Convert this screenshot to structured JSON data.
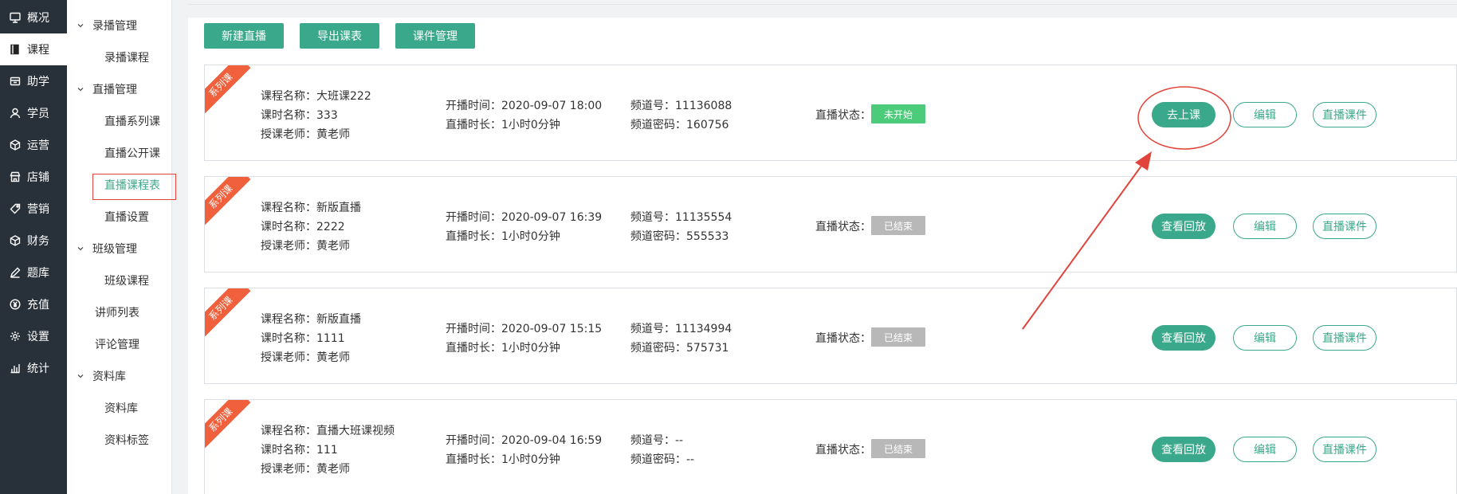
{
  "nav": {
    "items": [
      {
        "label": "概况",
        "icon": "monitor-icon"
      },
      {
        "label": "课程",
        "icon": "book-icon"
      },
      {
        "label": "助学",
        "icon": "box-icon"
      },
      {
        "label": "学员",
        "icon": "user-icon"
      },
      {
        "label": "运营",
        "icon": "cube-icon"
      },
      {
        "label": "店铺",
        "icon": "store-icon"
      },
      {
        "label": "营销",
        "icon": "tag-icon"
      },
      {
        "label": "财务",
        "icon": "cube-icon"
      },
      {
        "label": "题库",
        "icon": "pen-icon"
      },
      {
        "label": "充值",
        "icon": "yen-icon"
      },
      {
        "label": "设置",
        "icon": "gear-icon"
      },
      {
        "label": "统计",
        "icon": "chart-icon"
      }
    ]
  },
  "submenu": {
    "recorded_group": "录播管理",
    "recorded_course": "录播课程",
    "live_group": "直播管理",
    "live_series": "直播系列课",
    "live_open": "直播公开课",
    "live_schedule": "直播课程表",
    "live_settings": "直播设置",
    "class_group": "班级管理",
    "class_course": "班级课程",
    "teacher_list": "讲师列表",
    "review_mgmt": "评论管理",
    "library_group": "资料库",
    "library": "资料库",
    "library_tags": "资料标签"
  },
  "toolbar": {
    "new_live": "新建直播",
    "export_schedule": "导出课表",
    "courseware_mgmt": "课件管理"
  },
  "labels": {
    "ribbon": "系列课",
    "course_name": "课程名称：",
    "lesson_name": "课时名称：",
    "teacher": "授课老师：",
    "start_time": "开播时间：",
    "duration": "直播时长：",
    "channel_no": "频道号：",
    "channel_pwd": "频道密码：",
    "status": "直播状态：",
    "edit": "编辑",
    "courseware": "直播课件"
  },
  "courses": [
    {
      "course": "大班课222",
      "lesson": "333",
      "teacher": "黄老师",
      "start": "2020-09-07 18:00",
      "duration": "1小时0分钟",
      "channel": "11136088",
      "password": "160756",
      "status": "未开始",
      "action": "去上课"
    },
    {
      "course": "新版直播",
      "lesson": "2222",
      "teacher": "黄老师",
      "start": "2020-09-07 16:39",
      "duration": "1小时0分钟",
      "channel": "11135554",
      "password": "555533",
      "status": "已结束",
      "action": "查看回放"
    },
    {
      "course": "新版直播",
      "lesson": "1111",
      "teacher": "黄老师",
      "start": "2020-09-07 15:15",
      "duration": "1小时0分钟",
      "channel": "11134994",
      "password": "575731",
      "status": "已结束",
      "action": "查看回放"
    },
    {
      "course": "直播大班课视频",
      "lesson": "111",
      "teacher": "黄老师",
      "start": "2020-09-04 16:59",
      "duration": "1小时0分钟",
      "channel": "--",
      "password": "--",
      "status": "已结束",
      "action": "查看回放"
    }
  ],
  "colors": {
    "accent": "#3aa88a",
    "nav_bg": "#283039",
    "ribbon": "#f0603c",
    "status_not_started": "#4ccb7a",
    "status_ended": "#b8b8b8",
    "annotation": "#e0443a"
  }
}
